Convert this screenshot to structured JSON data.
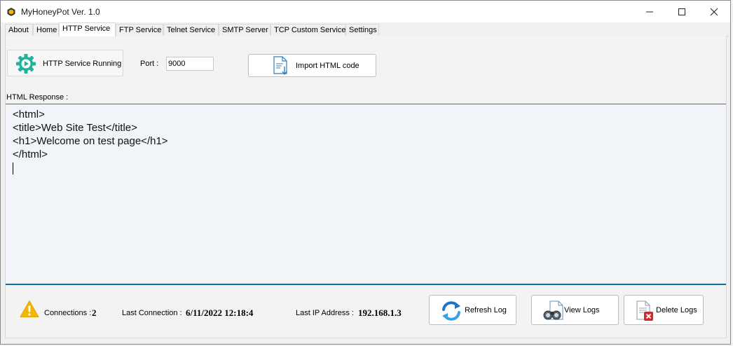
{
  "window": {
    "title": "MyHoneyPot Ver. 1.0",
    "app_icon": "honeypot-icon",
    "controls": [
      "minimize-icon",
      "maximize-icon",
      "close-icon"
    ]
  },
  "tabs": [
    {
      "label": "About",
      "active": false
    },
    {
      "label": "Home",
      "active": false
    },
    {
      "label": "HTTP Service",
      "active": true
    },
    {
      "label": "FTP Service",
      "active": false
    },
    {
      "label": "Telnet Service",
      "active": false
    },
    {
      "label": "SMTP Server",
      "active": false
    },
    {
      "label": "TCP Custom Service",
      "active": false
    },
    {
      "label": "Settings",
      "active": false
    }
  ],
  "service": {
    "status_label": "HTTP Service Running",
    "status_icon": "gear-play-icon",
    "port_label": "Port :",
    "port_value": "9000",
    "import_label": "Import HTML code",
    "import_icon": "document-import-icon"
  },
  "response": {
    "label": "HTML Response :",
    "lines": [
      "<html>",
      "<title>Web Site Test</title>",
      "<h1>Welcome on test page</h1>",
      "</html>"
    ]
  },
  "footer": {
    "warning_icon": "warning-icon",
    "connections_label": "Connections :",
    "connections_value": "2",
    "last_connection_label": "Last Connection :",
    "last_connection_value": "6/11/2022 12:18:4",
    "last_ip_label": "Last IP Address :",
    "last_ip_value": "192.168.1.3",
    "refresh_label": "Refresh Log",
    "view_label": "View Logs",
    "delete_label": "Delete Logs"
  },
  "colors": {
    "accent": "#0f6fa3",
    "gear": "#1fb39a",
    "warning": "#f2b800",
    "delete_red": "#d9262b"
  }
}
